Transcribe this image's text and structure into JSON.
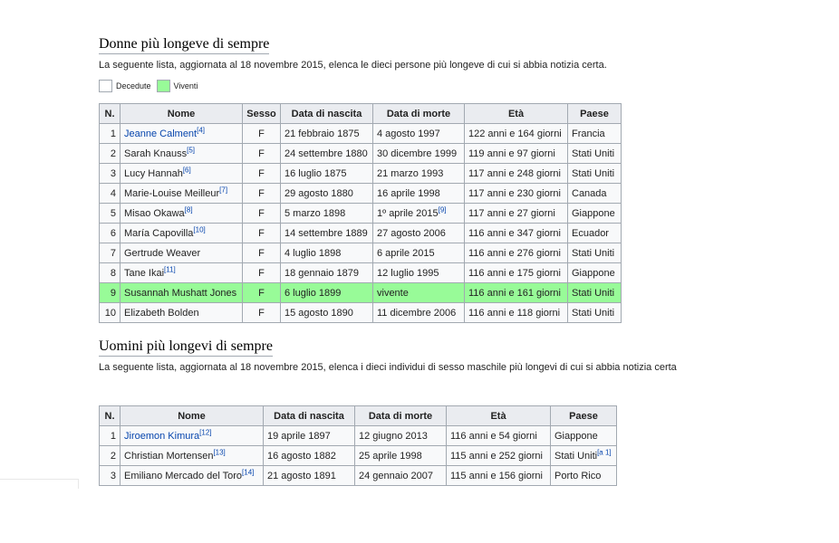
{
  "women": {
    "title": "Donne più longeve di sempre",
    "intro": "La seguente lista, aggiornata al 18 novembre 2015, elenca le dieci persone più longeve di cui si abbia notizia certa.",
    "legend": [
      {
        "label": "Decedute",
        "color": "#ffffff"
      },
      {
        "label": "Viventi",
        "color": "#98fb98"
      }
    ],
    "headers": [
      "N.",
      "Nome",
      "Sesso",
      "Data di nascita",
      "Data di morte",
      "Età",
      "Paese"
    ],
    "rows": [
      {
        "n": "1",
        "name": "Jeanne Calment",
        "ref": "[4]",
        "link": true,
        "sex": "F",
        "birth": "21 febbraio 1875",
        "death": "4 agosto 1997",
        "death_ref": "",
        "age": "122 anni e 164 giorni",
        "country": "Francia"
      },
      {
        "n": "2",
        "name": "Sarah Knauss",
        "ref": "[5]",
        "link": false,
        "sex": "F",
        "birth": "24 settembre 1880",
        "death": "30 dicembre 1999",
        "death_ref": "",
        "age": "119 anni e 97 giorni",
        "country": "Stati Uniti"
      },
      {
        "n": "3",
        "name": "Lucy Hannah",
        "ref": "[6]",
        "link": false,
        "sex": "F",
        "birth": "16 luglio 1875",
        "death": "21 marzo 1993",
        "death_ref": "",
        "age": "117 anni e 248 giorni",
        "country": "Stati Uniti"
      },
      {
        "n": "4",
        "name": "Marie-Louise Meilleur",
        "ref": "[7]",
        "link": false,
        "sex": "F",
        "birth": "29 agosto 1880",
        "death": "16 aprile 1998",
        "death_ref": "",
        "age": "117 anni e 230 giorni",
        "country": "Canada"
      },
      {
        "n": "5",
        "name": "Misao Okawa",
        "ref": "[8]",
        "link": false,
        "sex": "F",
        "birth": "5 marzo 1898",
        "death": "1º aprile 2015",
        "death_ref": "[9]",
        "age": "117 anni e 27 giorni",
        "country": "Giappone"
      },
      {
        "n": "6",
        "name": "María Capovilla",
        "ref": "[10]",
        "link": false,
        "sex": "F",
        "birth": "14 settembre 1889",
        "death": "27 agosto 2006",
        "death_ref": "",
        "age": "116 anni e 347 giorni",
        "country": "Ecuador"
      },
      {
        "n": "7",
        "name": "Gertrude Weaver",
        "ref": "",
        "link": false,
        "sex": "F",
        "birth": "4 luglio 1898",
        "death": "6 aprile 2015",
        "death_ref": "",
        "age": "116 anni e 276 giorni",
        "country": "Stati Uniti"
      },
      {
        "n": "8",
        "name": "Tane Ikai",
        "ref": "[11]",
        "link": false,
        "sex": "F",
        "birth": "18 gennaio 1879",
        "death": "12 luglio 1995",
        "death_ref": "",
        "age": "116 anni e 175 giorni",
        "country": "Giappone"
      },
      {
        "n": "9",
        "name": "Susannah Mushatt Jones",
        "ref": "",
        "link": false,
        "sex": "F",
        "birth": "6 luglio 1899",
        "death": "vivente",
        "death_ref": "",
        "age": "116 anni e 161 giorni",
        "country": "Stati Uniti",
        "living": true
      },
      {
        "n": "10",
        "name": "Elizabeth Bolden",
        "ref": "",
        "link": false,
        "sex": "F",
        "birth": "15 agosto 1890",
        "death": "11 dicembre 2006",
        "death_ref": "",
        "age": "116 anni e 118 giorni",
        "country": "Stati Uniti"
      }
    ]
  },
  "men": {
    "title": "Uomini più longevi di sempre",
    "intro": "La seguente lista, aggiornata al 18 novembre 2015, elenca i dieci individui di sesso maschile più longevi di cui si abbia notizia certa",
    "headers": [
      "N.",
      "Nome",
      "Data di nascita",
      "Data di morte",
      "Età",
      "Paese"
    ],
    "rows": [
      {
        "n": "1",
        "name": "Jiroemon Kimura",
        "ref": "[12]",
        "link": true,
        "birth": "19 aprile 1897",
        "death": "12 giugno 2013",
        "age": "116 anni e 54 giorni",
        "country": "Giappone",
        "country_ref": ""
      },
      {
        "n": "2",
        "name": "Christian Mortensen",
        "ref": "[13]",
        "link": false,
        "birth": "16 agosto 1882",
        "death": "25 aprile 1998",
        "age": "115 anni e 252 giorni",
        "country": "Stati Uniti",
        "country_ref": "[a 1]"
      },
      {
        "n": "3",
        "name": "Emiliano Mercado del Toro",
        "ref": "[14]",
        "link": false,
        "birth": "21 agosto 1891",
        "death": "24 gennaio 2007",
        "age": "115 anni e 156 giorni",
        "country": "Porto Rico",
        "country_ref": ""
      }
    ]
  }
}
